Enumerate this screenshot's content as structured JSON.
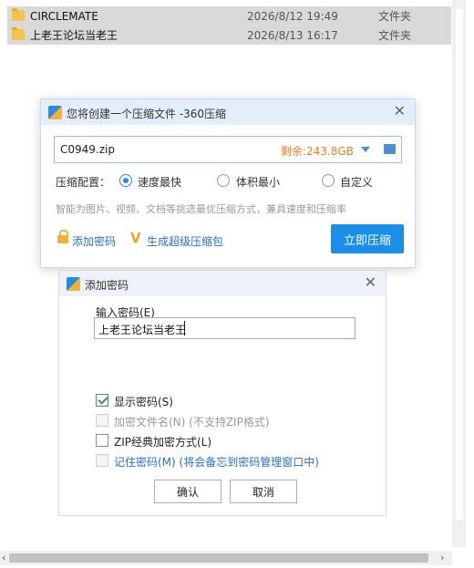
{
  "files": [
    {
      "name": "CIRCLEMATE",
      "date": "2026/8/12 19:49",
      "type": "文件夹"
    },
    {
      "name": "上老王论坛当老王",
      "date": "2026/8/13 16:17",
      "type": "文件夹"
    }
  ],
  "compress_dialog": {
    "title": "您将创建一个压缩文件 -360压缩",
    "filename": "C0949.zip",
    "remaining": "剩余:243.8GB",
    "mode_label": "压缩配置：",
    "modes": [
      "速度最快",
      "体积最小",
      "自定义"
    ],
    "selected_mode": "速度最快",
    "hint": "智能为图片、视频、文档等挑选最优压缩方式，兼具速度和压缩率",
    "add_password": "添加密码",
    "make_vip": "生成超级压缩包",
    "compress_button": "立即压缩"
  },
  "password_dialog": {
    "title": "添加密码",
    "input_label": "输入密码(E)",
    "password_value": "上老王论坛当老王",
    "options": [
      {
        "label": "显示密码(S)",
        "checked": true,
        "enabled": true
      },
      {
        "label": "加密文件名(N)  (不支持ZIP格式)",
        "checked": false,
        "enabled": false
      },
      {
        "label": "ZIP经典加密方式(L)",
        "checked": false,
        "enabled": true
      },
      {
        "label": "记住密码(M)  (将会备忘到密码管理窗口中)",
        "checked": false,
        "enabled": false
      }
    ],
    "ok": "确认",
    "cancel": "取消"
  }
}
